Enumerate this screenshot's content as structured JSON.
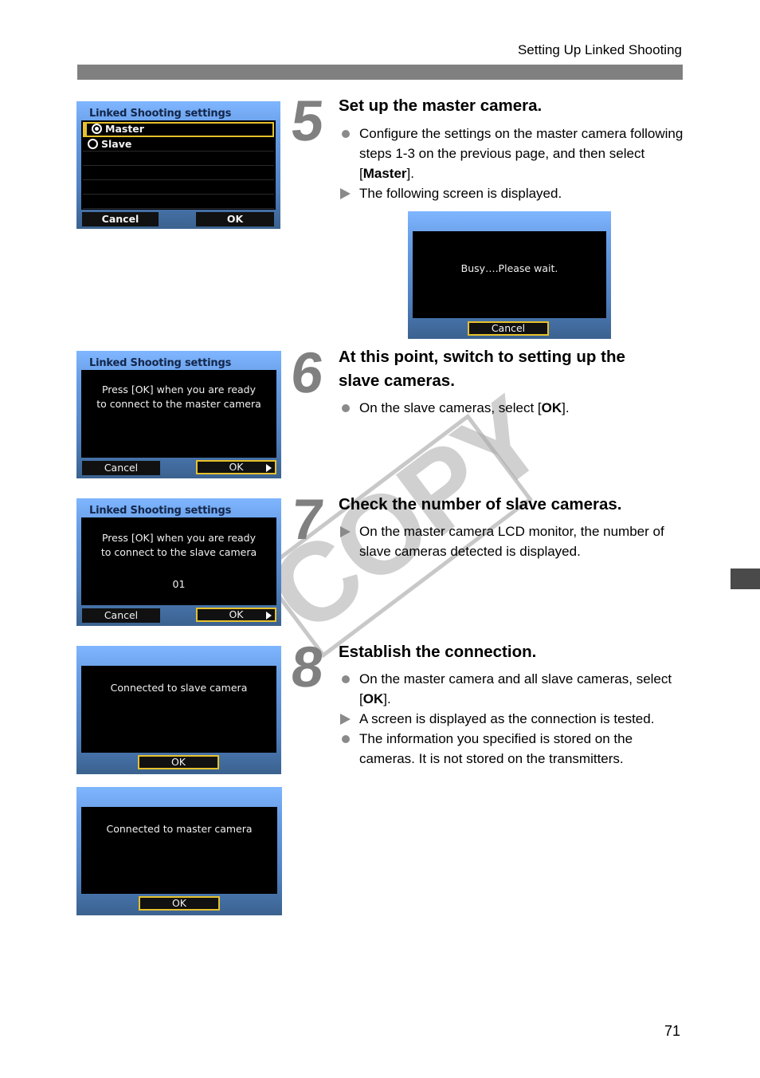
{
  "header": {
    "running_head": "Setting Up Linked Shooting"
  },
  "footer": {
    "page_number": "71"
  },
  "watermark": {
    "text": "COPY"
  },
  "steps": [
    {
      "number": "5",
      "title": "Set up the master camera.",
      "items": [
        {
          "type": "bullet",
          "text_before": "Configure the settings on the master camera following steps 1-3 on the previous page, and then select [",
          "bold": "Master",
          "text_after": "]."
        },
        {
          "type": "result",
          "text": "The following screen is displayed."
        }
      ]
    },
    {
      "number": "6",
      "title": "At this point, switch to setting up the slave cameras.",
      "items": [
        {
          "type": "bullet",
          "text_before": "On the slave cameras, select [",
          "bold": "OK",
          "text_after": "]."
        }
      ]
    },
    {
      "number": "7",
      "title": "Check the number of slave cameras.",
      "items": [
        {
          "type": "result",
          "text": "On the master camera LCD monitor, the number of slave cameras detected is displayed."
        }
      ]
    },
    {
      "number": "8",
      "title": "Establish the connection.",
      "items": [
        {
          "type": "bullet",
          "text_before": "On the master camera and all slave cameras, select [",
          "bold": "OK",
          "text_after": "]."
        },
        {
          "type": "result",
          "text": "A screen is displayed as the connection is tested."
        },
        {
          "type": "bullet",
          "text": "The information you specified is stored on the cameras. It is not stored on the transmitters."
        }
      ]
    }
  ],
  "screens": {
    "linked_settings": {
      "title": "Linked Shooting settings",
      "options": [
        {
          "label": "Master",
          "selected": true
        },
        {
          "label": "Slave",
          "selected": false
        }
      ],
      "cancel": "Cancel",
      "ok": "OK"
    },
    "busy": {
      "message": "Busy….Please wait.",
      "cancel": "Cancel"
    },
    "ready_master": {
      "title": "Linked Shooting settings",
      "line1": "Press [OK] when you are ready",
      "line2": "to connect to the master camera",
      "cancel": "Cancel",
      "ok": "OK"
    },
    "ready_slave": {
      "title": "Linked Shooting settings",
      "line1": "Press [OK] when you are ready",
      "line2": "to connect to the slave camera",
      "count": "01",
      "cancel": "Cancel",
      "ok": "OK"
    },
    "connected_slave": {
      "message": "Connected to slave camera",
      "ok": "OK"
    },
    "connected_master": {
      "message": "Connected to master camera",
      "ok": "OK"
    }
  },
  "colors": {
    "selection_border": "#e6c12b",
    "header_bar": "#808080",
    "step_number": "#808080"
  }
}
